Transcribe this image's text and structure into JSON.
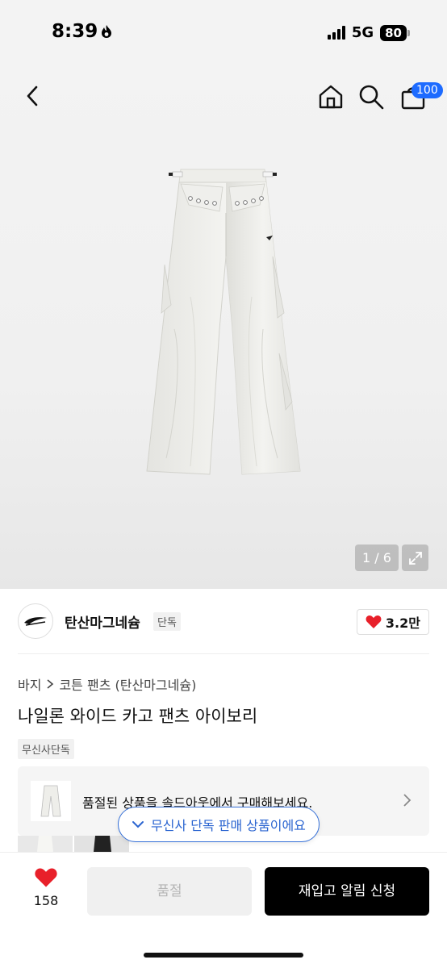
{
  "status_bar": {
    "time": "8:39",
    "network": "5G",
    "battery": "80"
  },
  "nav": {
    "cart_count": "100"
  },
  "gallery": {
    "counter": "1 / 6"
  },
  "brand": {
    "name": "탄산마그네슘",
    "tag": "단독",
    "likes": "3.2만"
  },
  "breadcrumb": {
    "category": "바지",
    "subcategory": "코튼 팬츠 (탄산마그네슘)"
  },
  "product": {
    "title": "나일론 와이드 카고 팬츠 아이보리",
    "exclusive_tag": "무신사단독"
  },
  "soldout_banner": {
    "text": "품절된 상품을 솔드아웃에서 구매해보세요."
  },
  "exclusive_pill": {
    "text": "무신사 단독 판매 상품이에요"
  },
  "bottom_bar": {
    "wish_count": "158",
    "soldout_label": "품절",
    "restock_label": "재입고 알림 신청"
  },
  "colors": {
    "accent_blue": "#2a64d0",
    "badge_blue": "#1d6bff",
    "heart_red": "#e8202a"
  }
}
